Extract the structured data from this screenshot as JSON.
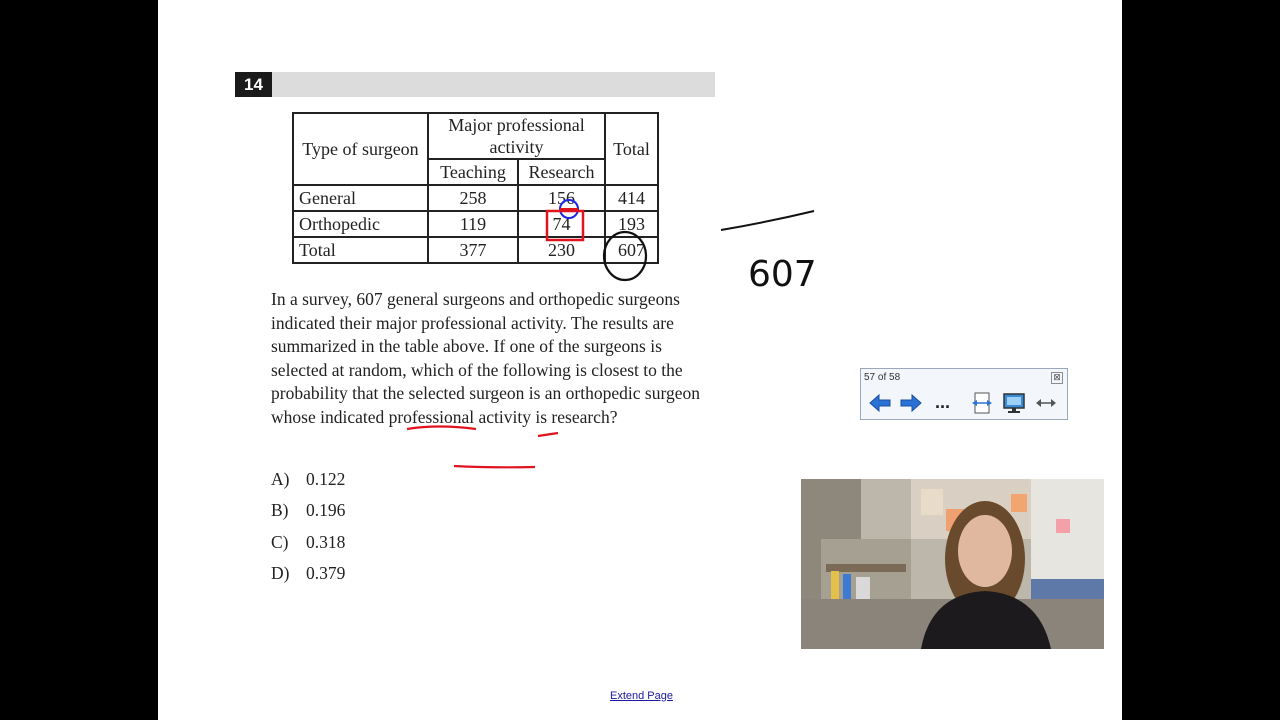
{
  "question": {
    "number": "14",
    "table": {
      "header_type": "Type of surgeon",
      "header_activity": "Major professional activity",
      "header_total": "Total",
      "sub_teaching": "Teaching",
      "sub_research": "Research",
      "rows": [
        {
          "label": "General",
          "teaching": "258",
          "research": "156",
          "total": "414"
        },
        {
          "label": "Orthopedic",
          "teaching": "119",
          "research": "74",
          "total": "193"
        },
        {
          "label": "Total",
          "teaching": "377",
          "research": "230",
          "total": "607"
        }
      ]
    },
    "text": "In a survey, 607 general surgeons and orthopedic surgeons indicated their major professional activity. The results are summarized in the table above. If one of the surgeons is selected at random, which of the following is closest to the probability that the selected surgeon is an orthopedic surgeon whose indicated professional activity is research?",
    "choices": [
      {
        "letter": "A)",
        "value": "0.122"
      },
      {
        "letter": "B)",
        "value": "0.196"
      },
      {
        "letter": "C)",
        "value": "0.318"
      },
      {
        "letter": "D)",
        "value": "0.379"
      }
    ]
  },
  "handwriting": {
    "denominator": "607",
    "pen_red": "#e0141e",
    "pen_blue": "#1a2adf",
    "pen_black": "#111111"
  },
  "extend_link": "Extend Page",
  "page_nav": {
    "title": "57 of 58",
    "close_glyph": "⊠",
    "more_glyph": "...",
    "icons": [
      "back-arrow-icon",
      "forward-arrow-icon",
      "more-icon",
      "fit-page-icon",
      "display-icon",
      "fit-width-icon"
    ]
  },
  "colors": {
    "background": "#000000",
    "page": "#ffffff",
    "arrow_blue": "#2a72d6"
  }
}
